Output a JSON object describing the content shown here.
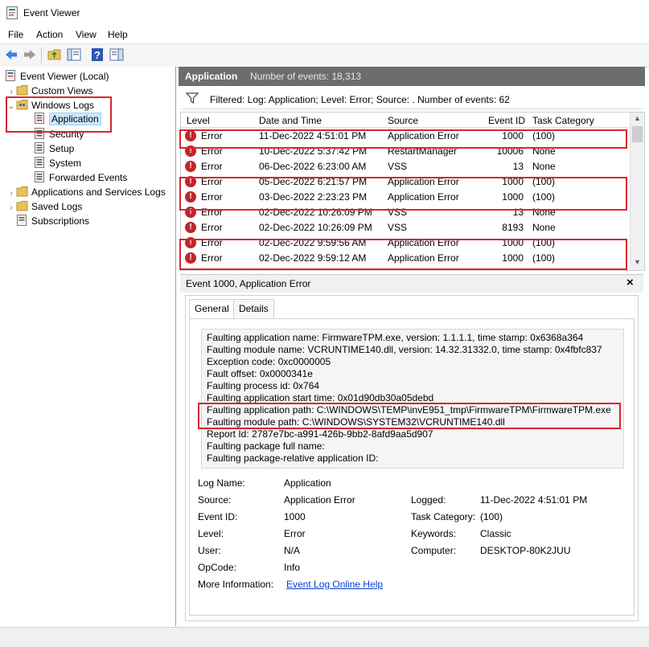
{
  "window": {
    "title": "Event Viewer"
  },
  "menu": {
    "items": [
      "File",
      "Action",
      "View",
      "Help"
    ]
  },
  "toolbar": {
    "icons": [
      "back-arrow-icon",
      "forward-arrow-icon",
      "folder-up-icon",
      "show-hide-tree-icon",
      "help-icon",
      "action-pane-icon"
    ]
  },
  "tree": {
    "root": "Event Viewer (Local)",
    "custom_views": "Custom Views",
    "windows_logs": "Windows Logs",
    "application": "Application",
    "security": "Security",
    "setup": "Setup",
    "system": "System",
    "forwarded": "Forwarded Events",
    "apps_services": "Applications and Services Logs",
    "saved_logs": "Saved Logs",
    "subscriptions": "Subscriptions"
  },
  "pane": {
    "name": "Application",
    "count_label": "Number of events: 18,313",
    "filter_text": "Filtered: Log: Application; Level: Error; Source: . Number of events: 62"
  },
  "grid": {
    "headers": [
      "Level",
      "Date and Time",
      "Source",
      "Event ID",
      "Task Category"
    ],
    "rows": [
      {
        "level": "Error",
        "date": "11-Dec-2022 4:51:01 PM",
        "source": "Application Error",
        "id": "1000",
        "task": "(100)"
      },
      {
        "level": "Error",
        "date": "10-Dec-2022 5:37:42 PM",
        "source": "RestartManager",
        "id": "10006",
        "task": "None"
      },
      {
        "level": "Error",
        "date": "06-Dec-2022 6:23:00 AM",
        "source": "VSS",
        "id": "13",
        "task": "None"
      },
      {
        "level": "Error",
        "date": "05-Dec-2022 6:21:57 PM",
        "source": "Application Error",
        "id": "1000",
        "task": "(100)"
      },
      {
        "level": "Error",
        "date": "03-Dec-2022 2:23:23 PM",
        "source": "Application Error",
        "id": "1000",
        "task": "(100)"
      },
      {
        "level": "Error",
        "date": "02-Dec-2022 10:26:09 PM",
        "source": "VSS",
        "id": "13",
        "task": "None"
      },
      {
        "level": "Error",
        "date": "02-Dec-2022 10:26:09 PM",
        "source": "VSS",
        "id": "8193",
        "task": "None"
      },
      {
        "level": "Error",
        "date": "02-Dec-2022 9:59:56 AM",
        "source": "Application Error",
        "id": "1000",
        "task": "(100)"
      },
      {
        "level": "Error",
        "date": "02-Dec-2022 9:59:12 AM",
        "source": "Application Error",
        "id": "1000",
        "task": "(100)"
      }
    ]
  },
  "detail": {
    "title": "Event 1000, Application Error",
    "tabs": [
      "General",
      "Details"
    ],
    "description": [
      "Faulting application name: FirmwareTPM.exe, version: 1.1.1.1, time stamp: 0x6368a364",
      "Faulting module name: VCRUNTIME140.dll, version: 14.32.31332.0, time stamp: 0x4fbfc837",
      "Exception code: 0xc0000005",
      "Fault offset: 0x0000341e",
      "Faulting process id: 0x764",
      "Faulting application start time: 0x01d90db30a05debd",
      "Faulting application path: C:\\WINDOWS\\TEMP\\invE951_tmp\\FirmwareTPM\\FirmwareTPM.exe",
      "Faulting module path: C:\\WINDOWS\\SYSTEM32\\VCRUNTIME140.dll",
      "Report Id: 2787e7bc-a991-426b-9bb2-8afd9aa5d907",
      "Faulting package full name:",
      "Faulting package-relative application ID:"
    ],
    "props": {
      "log_name_label": "Log Name:",
      "log_name": "Application",
      "source_label": "Source:",
      "source": "Application Error",
      "logged_label": "Logged:",
      "logged": "11-Dec-2022 4:51:01 PM",
      "event_id_label": "Event ID:",
      "event_id": "1000",
      "task_label": "Task Category:",
      "task": "(100)",
      "level_label": "Level:",
      "level": "Error",
      "keywords_label": "Keywords:",
      "keywords": "Classic",
      "user_label": "User:",
      "user": "N/A",
      "computer_label": "Computer:",
      "computer": "DESKTOP-80K2JUU",
      "opcode_label": "OpCode:",
      "opcode": "Info",
      "more_info_label": "More Information:",
      "more_info_link": "Event Log Online Help"
    }
  },
  "colors": {
    "highlight": "#d9262e",
    "pane_header": "#6d6d6d",
    "selection": "#cce8ff",
    "error": "#c0262d",
    "link": "#0a3ccf"
  }
}
